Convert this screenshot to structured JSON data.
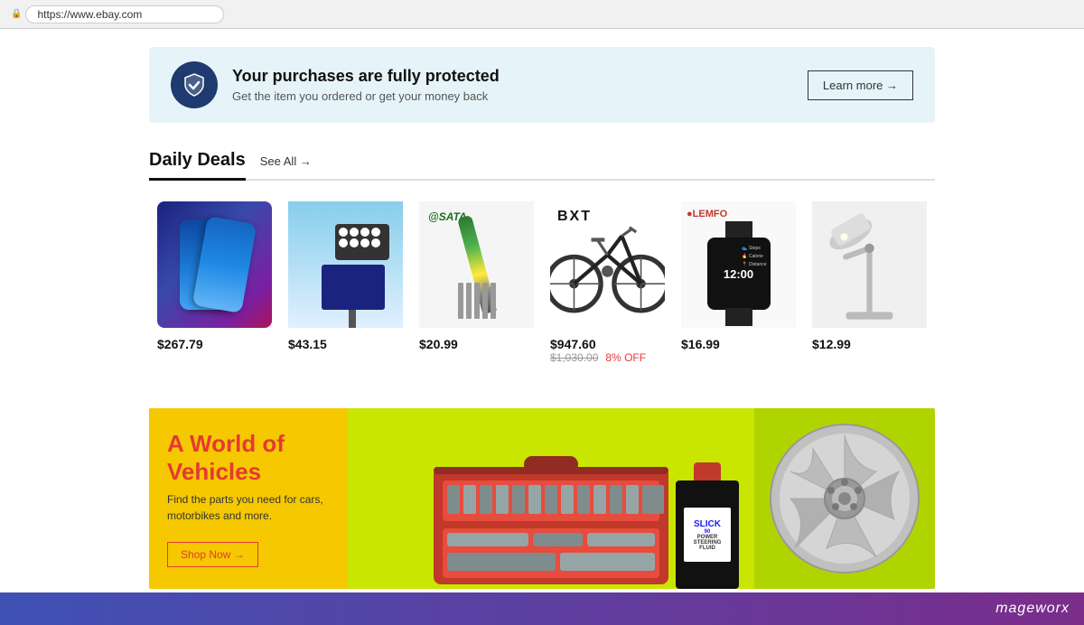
{
  "browser": {
    "url": "https://www.ebay.com",
    "lock_icon": "🔒"
  },
  "protection_banner": {
    "title": "Your purchases are fully protected",
    "subtitle": "Get the item you ordered or get your money back",
    "learn_more": "Learn more →",
    "shield_check": "✓"
  },
  "daily_deals": {
    "title": "Daily Deals",
    "see_all": "See All →",
    "products": [
      {
        "id": "phone",
        "price": "$267.79",
        "original_price": null,
        "discount": null
      },
      {
        "id": "solar-light",
        "price": "$43.15",
        "original_price": null,
        "discount": null
      },
      {
        "id": "screwdriver",
        "price": "$20.99",
        "original_price": null,
        "discount": null
      },
      {
        "id": "bicycle",
        "price": "$947.60",
        "original_price": "$1,030.00",
        "discount": "8% OFF"
      },
      {
        "id": "watch",
        "price": "$16.99",
        "original_price": null,
        "discount": null
      },
      {
        "id": "lamp",
        "price": "$12.99",
        "original_price": null,
        "discount": null
      }
    ]
  },
  "vehicles_banner": {
    "title": "A World of Vehicles",
    "subtitle": "Find the parts you need for cars, motorbikes and more.",
    "shop_now": "Shop Now →"
  },
  "footer": {
    "brand": "mageworx"
  }
}
